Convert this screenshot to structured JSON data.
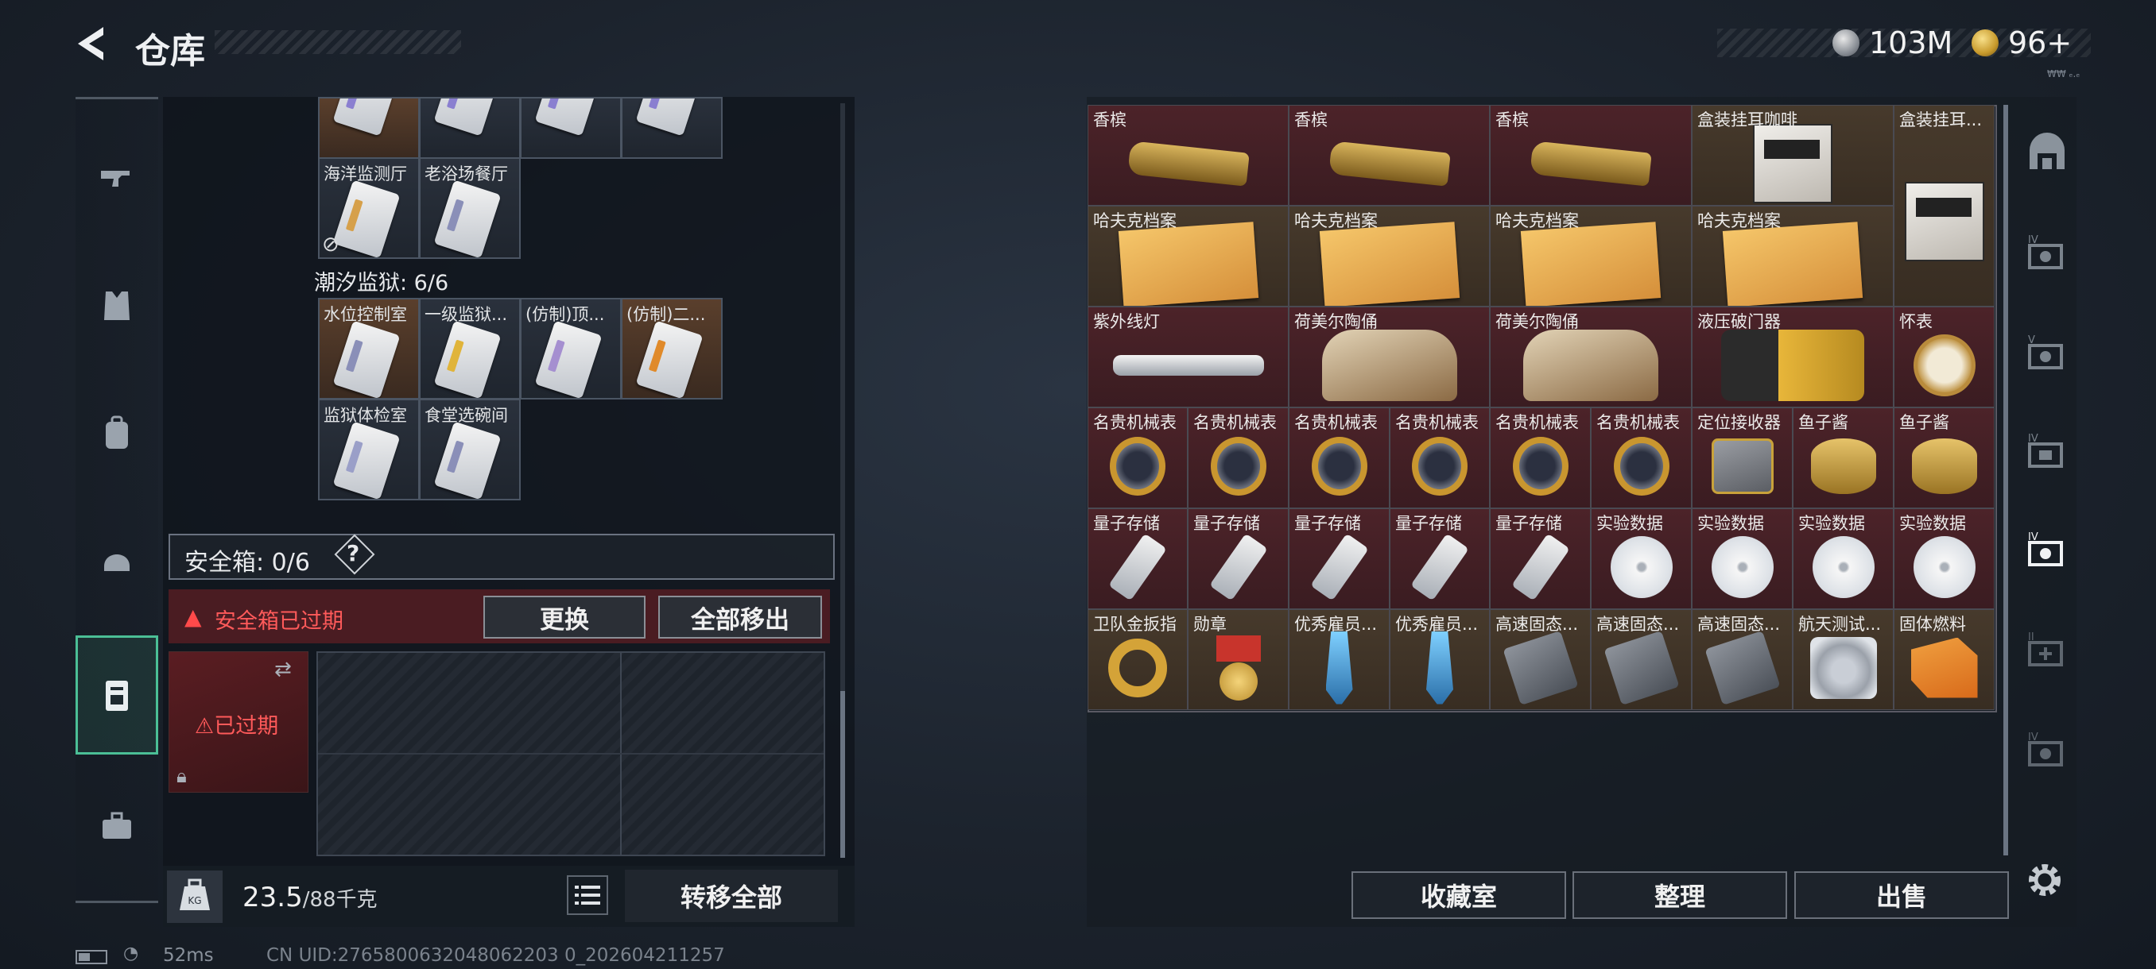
{
  "header": {
    "title": "仓库",
    "currencies": [
      {
        "icon": "silver-coin-icon",
        "value": "103M"
      },
      {
        "icon": "gold-coin-icon",
        "value": "96+"
      }
    ],
    "currency_small": "₩₩ ₑ.ₑ"
  },
  "left_nav": [
    {
      "icon": "gun-icon"
    },
    {
      "icon": "vest-icon"
    },
    {
      "icon": "backpack-icon"
    },
    {
      "icon": "helmet-icon"
    },
    {
      "icon": "keycard-case-icon",
      "active": true
    },
    {
      "icon": "toolbox-icon"
    }
  ],
  "keycards": {
    "top_row_labels": [
      "",
      "",
      "",
      ""
    ],
    "row1": [
      {
        "label": "海洋监测厅"
      },
      {
        "label": "老浴场餐厅"
      }
    ],
    "section_title": "潮汐监狱: 6/6",
    "row2": [
      {
        "label": "水位控制室"
      },
      {
        "label": "一级监狱..."
      },
      {
        "label": "(仿制)顶..."
      },
      {
        "label": "(仿制)二..."
      }
    ],
    "row3": [
      {
        "label": "监狱体检室"
      },
      {
        "label": "食堂选碗间"
      }
    ]
  },
  "safe_box": {
    "title": "安全箱: 0/6",
    "help": "?",
    "expired_notice": "安全箱已过期",
    "replace_button": "更换",
    "move_all_button": "全部移出",
    "expired_label": "已过期"
  },
  "footer_left": {
    "weight_value": "23.5",
    "weight_total": "/88千克",
    "transfer_all": "转移全部"
  },
  "items": [
    {
      "label": "香槟",
      "type": "bottle",
      "bg": "red"
    },
    {
      "label": "香槟",
      "type": "bottle",
      "bg": "red"
    },
    {
      "label": "香槟",
      "type": "bottle",
      "bg": "red"
    },
    {
      "label": "盒装挂耳咖啡",
      "type": "box",
      "bg": "brown"
    },
    {
      "label": "盒装挂耳...",
      "type": "box",
      "bg": "brown"
    },
    {
      "label": "哈夫克档案",
      "type": "folder",
      "bg": "brown"
    },
    {
      "label": "哈夫克档案",
      "type": "folder",
      "bg": "brown"
    },
    {
      "label": "哈夫克档案",
      "type": "folder",
      "bg": "brown"
    },
    {
      "label": "哈夫克档案",
      "type": "folder",
      "bg": "brown"
    },
    {
      "label": "紫外线灯",
      "type": "uv",
      "bg": "red"
    },
    {
      "label": "荷美尔陶俑",
      "type": "statue",
      "bg": "red"
    },
    {
      "label": "荷美尔陶俑",
      "type": "statue",
      "bg": "red"
    },
    {
      "label": "液压破门器",
      "type": "hydra",
      "bg": "red"
    },
    {
      "label": "怀表",
      "type": "pocketwatch",
      "bg": "red"
    },
    {
      "label": "名贵机械表",
      "type": "watch",
      "bg": "red"
    },
    {
      "label": "名贵机械表",
      "type": "watch",
      "bg": "red"
    },
    {
      "label": "名贵机械表",
      "type": "watch",
      "bg": "red"
    },
    {
      "label": "名贵机械表",
      "type": "watch",
      "bg": "red"
    },
    {
      "label": "名贵机械表",
      "type": "watch",
      "bg": "red"
    },
    {
      "label": "名贵机械表",
      "type": "watch",
      "bg": "red"
    },
    {
      "label": "定位接收器",
      "type": "tracker",
      "bg": "red"
    },
    {
      "label": "鱼子酱",
      "type": "caviar",
      "bg": "red"
    },
    {
      "label": "鱼子酱",
      "type": "caviar",
      "bg": "red"
    },
    {
      "label": "量子存储",
      "type": "usb",
      "bg": "red"
    },
    {
      "label": "量子存储",
      "type": "usb",
      "bg": "red"
    },
    {
      "label": "量子存储",
      "type": "usb",
      "bg": "red"
    },
    {
      "label": "量子存储",
      "type": "usb",
      "bg": "red"
    },
    {
      "label": "量子存储",
      "type": "usb",
      "bg": "red"
    },
    {
      "label": "实验数据",
      "type": "disc",
      "bg": "red"
    },
    {
      "label": "实验数据",
      "type": "disc",
      "bg": "red"
    },
    {
      "label": "实验数据",
      "type": "disc",
      "bg": "red"
    },
    {
      "label": "实验数据",
      "type": "disc",
      "bg": "red"
    },
    {
      "label": "卫队金扳指",
      "type": "ring",
      "bg": "brown"
    },
    {
      "label": "勋章",
      "type": "medal",
      "bg": "brown"
    },
    {
      "label": "优秀雇员...",
      "type": "trophy",
      "bg": "brown"
    },
    {
      "label": "优秀雇员...",
      "type": "trophy",
      "bg": "brown"
    },
    {
      "label": "高速固态...",
      "type": "ssd",
      "bg": "brown"
    },
    {
      "label": "高速固态...",
      "type": "ssd",
      "bg": "brown"
    },
    {
      "label": "高速固态...",
      "type": "ssd",
      "bg": "brown"
    },
    {
      "label": "航天测试...",
      "type": "aero",
      "bg": "brown"
    },
    {
      "label": "固体燃料",
      "type": "fuel",
      "bg": "brown"
    }
  ],
  "footer_right": {
    "collection": "收藏室",
    "sort": "整理",
    "sell": "出售"
  },
  "right_nav": [
    {
      "icon": "stash-tab-icon"
    },
    {
      "icon": "stash-iv-1-icon"
    },
    {
      "icon": "stash-v-icon"
    },
    {
      "icon": "stash-iv-2-icon"
    },
    {
      "icon": "stash-iv-3-icon",
      "active": true
    },
    {
      "icon": "stash-add-icon"
    },
    {
      "icon": "stash-iv-4-icon"
    }
  ],
  "status": {
    "ping": "52ms",
    "uid": "CN UID:2765800632048062203 0_202604211257"
  }
}
